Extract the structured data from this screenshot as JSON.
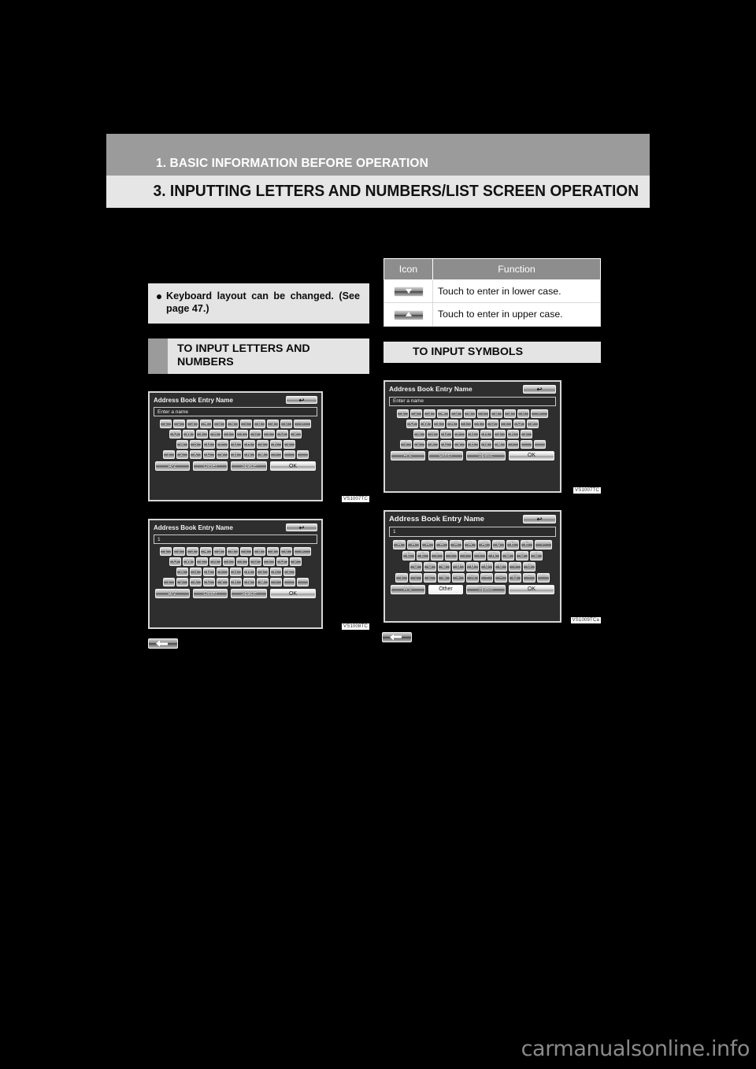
{
  "page": {
    "chapter_title": "1. BASIC INFORMATION BEFORE OPERATION",
    "section_title": "3. INPUTTING LETTERS AND NUMBERS/LIST SCREEN OPERATION",
    "watermark": "carmanualsonline.info"
  },
  "left_column": {
    "note": {
      "text": "Keyboard layout can be changed. (See page 47.)"
    },
    "subhead": {
      "title": "TO INPUT LETTERS AND NUMBERS"
    },
    "figure1": {
      "code": "VS1007TC",
      "screen": {
        "title": "Address Book Entry Name",
        "back_label": "↩",
        "field_value": "Enter a name",
        "row1": [
          "1",
          "2",
          "3",
          "4",
          "5",
          "6",
          "7",
          "8",
          "9",
          "0"
        ],
        "backspace": "←",
        "row2": [
          "Q",
          "W",
          "E",
          "R",
          "T",
          "Y",
          "U",
          "I",
          "O",
          "P"
        ],
        "row3": [
          "A",
          "S",
          "D",
          "F",
          "G",
          "H",
          "J",
          "K",
          "L"
        ],
        "row4_shift": "⇩",
        "row4": [
          "Z",
          "X",
          "C",
          "V",
          "B",
          "N",
          "M",
          "-",
          "'",
          "."
        ],
        "btn_az": "A-Z",
        "btn_other": "Other",
        "btn_space": "Space",
        "btn_ok": "OK"
      }
    },
    "figure2": {
      "code": "VS1008TC",
      "screen": {
        "title": "Address Book Entry Name",
        "back_label": "↩",
        "field_value": "1",
        "row1": [
          "1",
          "2",
          "3",
          "4",
          "5",
          "6",
          "7",
          "8",
          "9",
          "0"
        ],
        "backspace": "←",
        "row2": [
          "Q",
          "W",
          "E",
          "R",
          "T",
          "Y",
          "U",
          "I",
          "O",
          "P"
        ],
        "row3": [
          "A",
          "S",
          "D",
          "F",
          "G",
          "H",
          "J",
          "K",
          "L"
        ],
        "row4_shift": "⇩",
        "row4": [
          "Z",
          "X",
          "C",
          "V",
          "B",
          "N",
          "M",
          "-",
          "'",
          "."
        ],
        "btn_az": "A-Z",
        "btn_other": "Other",
        "btn_space": "Space",
        "btn_ok": "OK"
      }
    },
    "inline_icon": {
      "name": "backspace-key-icon"
    }
  },
  "right_column": {
    "table": {
      "headers": [
        "Icon",
        "Function"
      ],
      "rows": [
        {
          "icon": "shift-lower-case-icon",
          "function": "Touch to enter in lower case."
        },
        {
          "icon": "shift-upper-case-icon",
          "function": "Touch to enter in upper case."
        }
      ]
    },
    "subhead": {
      "title": "TO INPUT SYMBOLS"
    },
    "figure1": {
      "code": "VS1007TC",
      "screen": {
        "title": "Address Book Entry Name",
        "back_label": "↩",
        "field_value": "Enter a name",
        "row1": [
          "1",
          "2",
          "3",
          "4",
          "5",
          "6",
          "7",
          "8",
          "9",
          "0"
        ],
        "backspace": "←",
        "row2": [
          "Q",
          "W",
          "E",
          "R",
          "T",
          "Y",
          "U",
          "I",
          "O",
          "P"
        ],
        "row3": [
          "A",
          "S",
          "D",
          "F",
          "G",
          "H",
          "J",
          "K",
          "L"
        ],
        "row4_shift": "⇩",
        "row4": [
          "Z",
          "X",
          "C",
          "V",
          "B",
          "N",
          "M",
          "-",
          "'",
          "."
        ],
        "btn_az": "A-Z",
        "btn_other": "Other",
        "btn_space": "Space",
        "btn_ok": "OK"
      }
    },
    "figure2": {
      "code": "VS1009TCa",
      "screen": {
        "title": "Address Book Entry Name",
        "back_label": "↩",
        "field_value": "1",
        "row1": [
          "À",
          "Á",
          "Â",
          "Ã",
          "Ä",
          "Å",
          "Æ",
          "Ç",
          "È",
          "É"
        ],
        "backspace": "←",
        "row2": [
          "É",
          "Ê",
          "Ì",
          "Í",
          "Î",
          "Ï",
          "Ñ",
          "Ò",
          "Ó",
          "Ô"
        ],
        "row3": [
          "Õ",
          "Ö",
          "Ø",
          "Ù",
          "Ú",
          "Û",
          "Ü",
          "Ý",
          "ß"
        ],
        "row4_shift": "⇩",
        "row4": [
          "¡",
          "¿",
          "&",
          "#",
          "%",
          "+",
          "=",
          "@",
          "÷",
          "°"
        ],
        "btn_az": "A-Z",
        "btn_other": "Other",
        "btn_space": "Space",
        "btn_ok": "OK"
      }
    },
    "inline_icon": {
      "name": "backspace-key-icon"
    }
  }
}
